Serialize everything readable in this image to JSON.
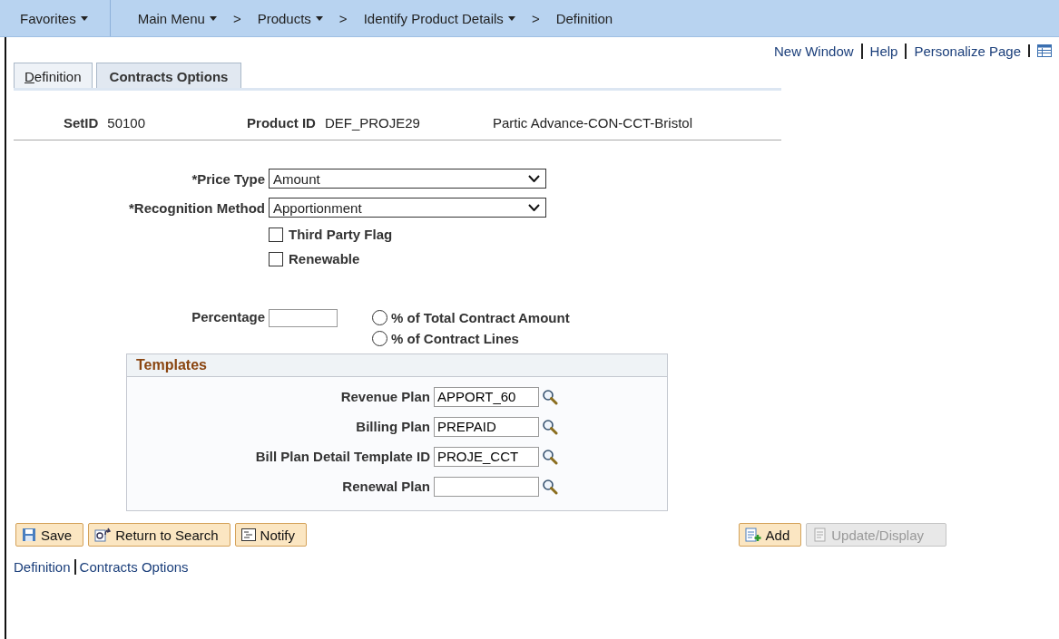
{
  "nav": [
    {
      "kind": "menu",
      "label": "Favorites",
      "dropdown": true
    },
    {
      "kind": "menu",
      "label": "Main Menu",
      "dropdown": true
    },
    {
      "kind": "separator",
      "label": ">"
    },
    {
      "kind": "menu",
      "label": "Products",
      "dropdown": true
    },
    {
      "kind": "separator",
      "label": ">"
    },
    {
      "kind": "menu",
      "label": "Identify Product Details",
      "dropdown": true
    },
    {
      "kind": "separator",
      "label": ">"
    },
    {
      "kind": "menu",
      "label": "Definition",
      "dropdown": false
    }
  ],
  "header_links": [
    "New Window",
    "Help",
    "Personalize Page"
  ],
  "tabs": [
    {
      "label": "Definition",
      "selected": false
    },
    {
      "label": "Contracts Options",
      "selected": true
    }
  ],
  "key_fields": [
    {
      "label": "SetID",
      "value": "50100"
    },
    {
      "label": "Product ID",
      "value": "DEF_PROJE29"
    },
    {
      "value": "Partic Advance-CON-CCT-Bristol"
    }
  ],
  "dropdowns": [
    {
      "label": "*Price Type",
      "value": "Amount"
    },
    {
      "label": "*Recognition Method",
      "value": "Apportionment"
    }
  ],
  "checkboxes": [
    {
      "label": "Third Party Flag",
      "checked": false
    },
    {
      "label": "Renewable",
      "checked": false
    }
  ],
  "percentage": {
    "label": "Percentage"
  },
  "radios": [
    {
      "label": "% of Total Contract Amount",
      "selected": false
    },
    {
      "label": "% of Contract Lines",
      "selected": false
    }
  ],
  "templates": {
    "title": "Templates",
    "fields": [
      {
        "label": "Revenue Plan",
        "value": "APPORT_60"
      },
      {
        "label": "Billing Plan",
        "value": "PREPAID"
      },
      {
        "label": "Bill Plan Detail Template ID",
        "value": "PROJE_CCT"
      },
      {
        "label": "Renewal Plan"
      }
    ]
  },
  "buttons": [
    {
      "kind": "save",
      "label": "Save",
      "disabled": false
    },
    {
      "kind": "return",
      "label": "Return to Search",
      "disabled": false
    },
    {
      "kind": "notify",
      "label": "Notify",
      "disabled": false
    }
  ],
  "right_buttons": [
    {
      "kind": "add",
      "label": "Add",
      "disabled": false
    },
    {
      "kind": "update",
      "label": "Update/Display",
      "disabled": true
    }
  ],
  "footer_links": [
    "Definition",
    "Contracts Options"
  ]
}
